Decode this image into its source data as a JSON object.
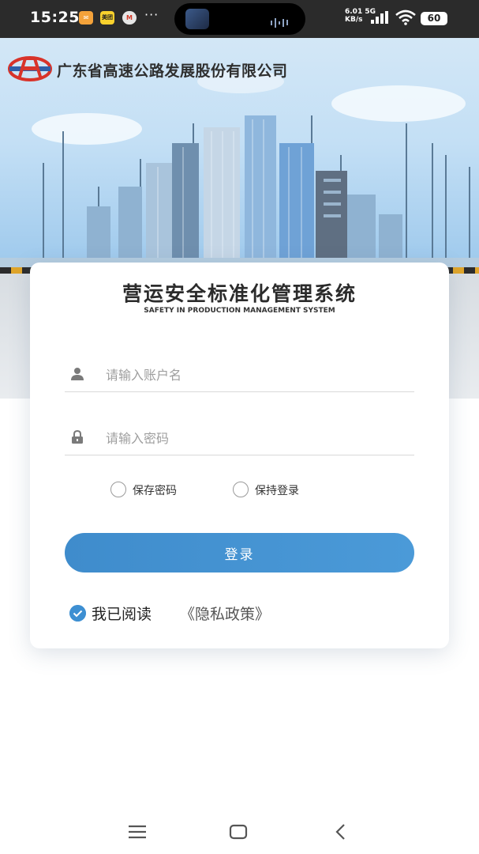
{
  "status_bar": {
    "time": "15:25",
    "notifications": [
      {
        "icon": "message-app-icon",
        "text": "✉"
      },
      {
        "icon": "meituan-app-icon",
        "text": "美团"
      },
      {
        "icon": "mcdonalds-app-icon",
        "text": "M"
      }
    ],
    "more": "···",
    "net_speed_value": "6.01",
    "net_speed_unit": "KB/s",
    "network_type": "5G",
    "battery": "60"
  },
  "header": {
    "company_name": "广东省高速公路发展股份有限公司",
    "colors": {
      "logo_red": "#d8332a",
      "logo_blue": "#2f5fa8"
    }
  },
  "card": {
    "title": "营运安全标准化管理系统",
    "subtitle": "SAFETY IN PRODUCTION MANAGEMENT SYSTEM"
  },
  "form": {
    "username": {
      "placeholder": "请输入账户名",
      "value": ""
    },
    "password": {
      "placeholder": "请输入密码",
      "value": ""
    },
    "save_password": {
      "label": "保存密码",
      "checked": false
    },
    "keep_login": {
      "label": "保持登录",
      "checked": false
    },
    "login_button": "登录"
  },
  "agreement": {
    "text": "我已阅读",
    "privacy_link": "《隐私政策》",
    "checked": true
  },
  "colors": {
    "accent": "#3f8ccc",
    "status_bar_bg": "#2b2b2b"
  },
  "nav": {
    "icons": [
      "menu-icon",
      "home-icon",
      "back-icon"
    ]
  }
}
